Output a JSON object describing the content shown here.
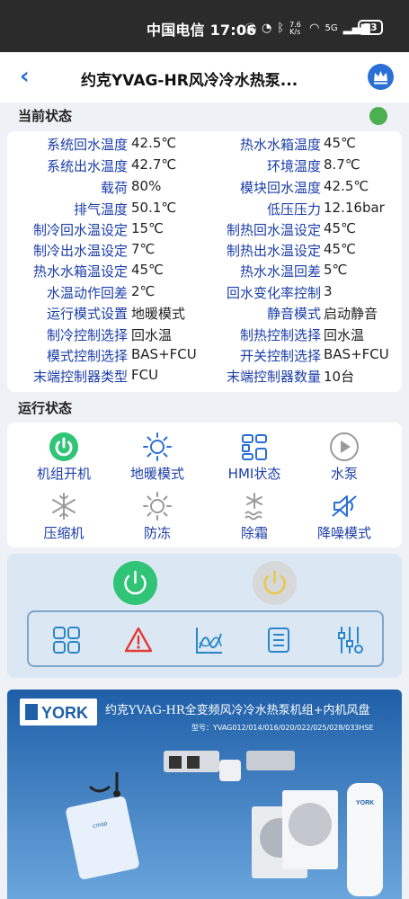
{
  "status_bar": {
    "carrier_time": "中国电信 17:06",
    "net_speed": "7.6 K/s",
    "network": "5G",
    "battery": "73"
  },
  "header": {
    "title": "约克YVAG-HR风冷冷水热泵...",
    "back_icon": "chevron-left-icon",
    "crown_icon": "crown-icon"
  },
  "current_status": {
    "title": "当前状态",
    "indicator_color": "#4caf50",
    "params": [
      {
        "label": "系统回水温度",
        "value": "42.5℃",
        "label2": "热水水箱温度",
        "value2": "45℃"
      },
      {
        "label": "系统出水温度",
        "value": "42.7℃",
        "label2": "环境温度",
        "value2": "8.7℃"
      },
      {
        "label": "载荷",
        "value": "80%",
        "label2": "模块回水温度",
        "value2": "42.5℃"
      },
      {
        "label": "排气温度",
        "value": "50.1℃",
        "label2": "低压压力",
        "value2": "12.16bar"
      },
      {
        "label": "制冷回水温设定",
        "value": "15℃",
        "label2": "制热回水温设定",
        "value2": "45℃"
      },
      {
        "label": "制冷出水温设定",
        "value": "7℃",
        "label2": "制热出水温设定",
        "value2": "45℃"
      },
      {
        "label": "热水水箱温设定",
        "value": "45℃",
        "label2": "热水水温回差",
        "value2": "5℃"
      },
      {
        "label": "水温动作回差",
        "value": "2℃",
        "label2": "回水变化率控制",
        "value2": "3"
      },
      {
        "label": "运行模式设置",
        "value": "地暖模式",
        "label2": "静音模式",
        "value2": "启动静音"
      },
      {
        "label": "制冷控制选择",
        "value": "回水温",
        "label2": "制热控制选择",
        "value2": "回水温"
      },
      {
        "label": "模式控制选择",
        "value": "BAS+FCU",
        "label2": "开关控制选择",
        "value2": "BAS+FCU"
      },
      {
        "label": "末端控制器类型",
        "value": "FCU",
        "label2": "末端控制器数量",
        "value2": "10台"
      }
    ]
  },
  "run_status": {
    "title": "运行状态",
    "items": [
      {
        "label": "机组开机",
        "icon": "power-on-icon"
      },
      {
        "label": "地暖模式",
        "icon": "sun-icon"
      },
      {
        "label": "HMI状态",
        "icon": "hmi-icon"
      },
      {
        "label": "水泵",
        "icon": "play-icon"
      },
      {
        "label": "压缩机",
        "icon": "snowflake-icon"
      },
      {
        "label": "防冻",
        "icon": "sun-outline-icon"
      },
      {
        "label": "除霜",
        "icon": "defrost-icon"
      },
      {
        "label": "降噪模式",
        "icon": "mute-icon"
      }
    ]
  },
  "control": {
    "power_on_color": "#2fc476",
    "power_off_color": "#d7d8da",
    "toolbar_icons": [
      "grid-icon",
      "warning-icon",
      "chart-icon",
      "list-icon",
      "settings-sliders-icon"
    ]
  },
  "banner": {
    "brand": "YORK",
    "headline": "约克YVAG-HR全变频风冷冷水热泵机组+内机风盘",
    "model_line": "型号：YVAG012/014/016/020/022/025/028/033HSE",
    "gateway_label": "cmap",
    "tank_label": "YORK"
  }
}
